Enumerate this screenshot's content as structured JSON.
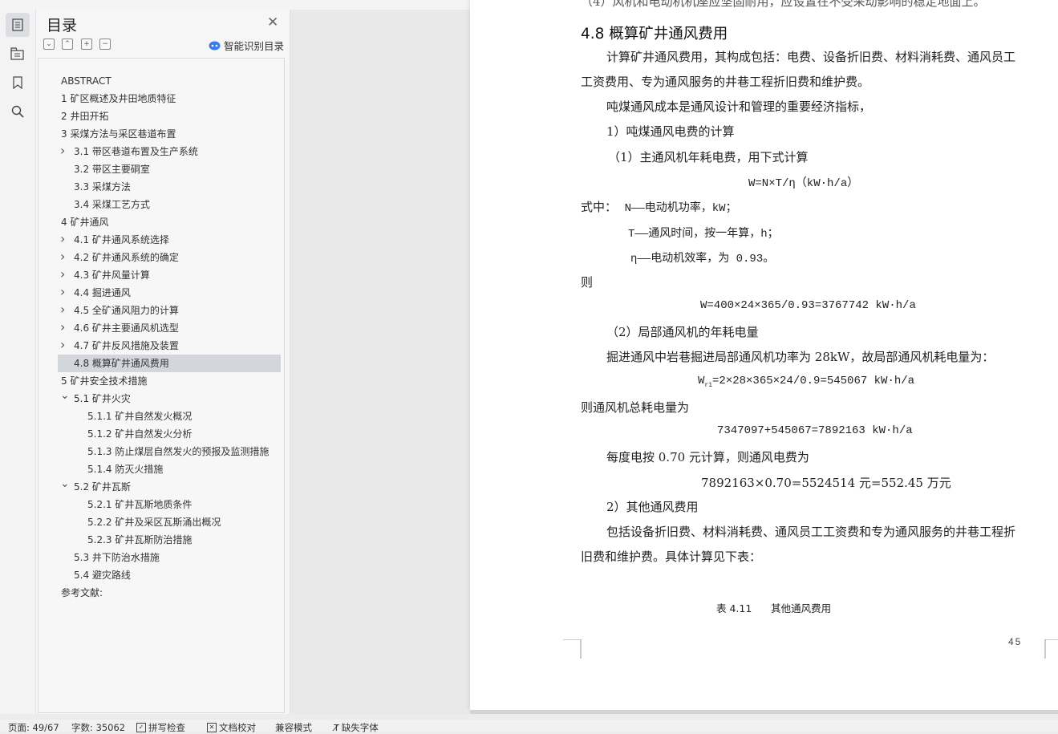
{
  "toc": {
    "title": "目录",
    "ai_label": "智能识别目录",
    "items": [
      {
        "label": "ABSTRACT",
        "level": 0,
        "chevron": ""
      },
      {
        "label": "1 矿区概述及井田地质特征",
        "level": 0,
        "chevron": "right"
      },
      {
        "label": "2 井田开拓",
        "level": 0,
        "chevron": "right"
      },
      {
        "label": "3 采煤方法与采区巷道布置",
        "level": 0,
        "chevron": "down"
      },
      {
        "label": "3.1 带区巷道布置及生产系统",
        "level": 1,
        "chevron": "right"
      },
      {
        "label": "3.2 带区主要硐室",
        "level": 1,
        "chevron": ""
      },
      {
        "label": "3.3 采煤方法",
        "level": 1,
        "chevron": ""
      },
      {
        "label": "3.4 采煤工艺方式",
        "level": 1,
        "chevron": ""
      },
      {
        "label": "4 矿井通风",
        "level": 0,
        "chevron": "down"
      },
      {
        "label": "4.1 矿井通风系统选择",
        "level": 1,
        "chevron": "right"
      },
      {
        "label": "4.2 矿井通风系统的确定",
        "level": 1,
        "chevron": "right"
      },
      {
        "label": "4.3 矿井风量计算",
        "level": 1,
        "chevron": "right"
      },
      {
        "label": "4.4 掘进通风",
        "level": 1,
        "chevron": "right"
      },
      {
        "label": "4.5 全矿通风阻力的计算",
        "level": 1,
        "chevron": "right"
      },
      {
        "label": "4.6 矿井主要通风机选型",
        "level": 1,
        "chevron": "right"
      },
      {
        "label": "4.7 矿井反风措施及装置",
        "level": 1,
        "chevron": "right"
      },
      {
        "label": "4.8 概算矿井通风费用",
        "level": 1,
        "chevron": "",
        "active": true
      },
      {
        "label": "5 矿井安全技术措施",
        "level": 0,
        "chevron": "down"
      },
      {
        "label": "5.1 矿井火灾",
        "level": 1,
        "chevron": "down"
      },
      {
        "label": "5.1.1 矿井自然发火概况",
        "level": 2,
        "chevron": ""
      },
      {
        "label": "5.1.2 矿井自然发火分析",
        "level": 2,
        "chevron": ""
      },
      {
        "label": "5.1.3 防止煤层自然发火的预报及监测措施",
        "level": 2,
        "chevron": ""
      },
      {
        "label": "5.1.4 防灭火措施",
        "level": 2,
        "chevron": ""
      },
      {
        "label": "5.2 矿井瓦斯",
        "level": 1,
        "chevron": "down"
      },
      {
        "label": "5.2.1 矿井瓦斯地质条件",
        "level": 2,
        "chevron": ""
      },
      {
        "label": "5.2.2 矿井及采区瓦斯涌出概况",
        "level": 2,
        "chevron": ""
      },
      {
        "label": "5.2.3 矿井瓦斯防治措施",
        "level": 2,
        "chevron": ""
      },
      {
        "label": "5.3 井下防治水措施",
        "level": 1,
        "chevron": ""
      },
      {
        "label": "5.4 避灾路线",
        "level": 1,
        "chevron": ""
      },
      {
        "label": "参考文献:",
        "level": 0,
        "chevron": ""
      }
    ]
  },
  "document": {
    "top_cut_line": "（4）风机和电动机机座应坚固耐用，应设置在不受采动影响的稳定地面上。",
    "heading": "4.8 概算矿井通风费用",
    "para1_line1": "计算矿井通风费用，其构成包括：电费、设备折旧费、材料消耗费、通风员工",
    "para1_line2": "工资费用、专为通风服务的井巷工程折旧费和维护费。",
    "para2": "吨煤通风成本是通风设计和管理的重要经济指标，",
    "item1": "1）吨煤通风电费的计算",
    "item1_sub": "（1）主通风机年耗电费，用下式计算",
    "formula1": "W=N×T/η（kW·h/a）",
    "where_prefix": "式中：",
    "where_n": "N——电动机功率，kW；",
    "where_t": "T——通风时间，按一年算，h；",
    "where_eta": "η——电动机效率，为 0.93。",
    "then": "则",
    "formula2": "W=400×24×365/0.93=3767742 kW·h/a",
    "item2_sub": "（2）局部通风机的年耗电量",
    "para3": "掘进通风中岩巷掘进局部通风机功率为 28kW，故局部通风机耗电量为：",
    "formula3_prefix": "W",
    "formula3_sub": "r1",
    "formula3_rest": "=2×28×365×24/0.9=545067 kW·h/a",
    "para4": "则通风机总耗电量为",
    "formula4": "7347097+545067=7892163 kW·h/a",
    "para5": "每度电按 0.70 元计算，则通风电费为",
    "formula5": "7892163×0.70=5524514 元=552.45 万元",
    "item3": "2）其他通风费用",
    "para6_line1": "包括设备折旧费、材料消耗费、通风员工工资费和专为通风服务的井巷工程折",
    "para6_line2": "旧费和维护费。具体计算见下表：",
    "table_caption": "表 4.11      其他通风费用",
    "page_number": "45"
  },
  "status": {
    "page": "页面: 49/67",
    "words": "字数: 35062",
    "spell": "拼写检查",
    "proof": "文档校对",
    "compat": "兼容模式",
    "missing_font": "缺失字体"
  }
}
